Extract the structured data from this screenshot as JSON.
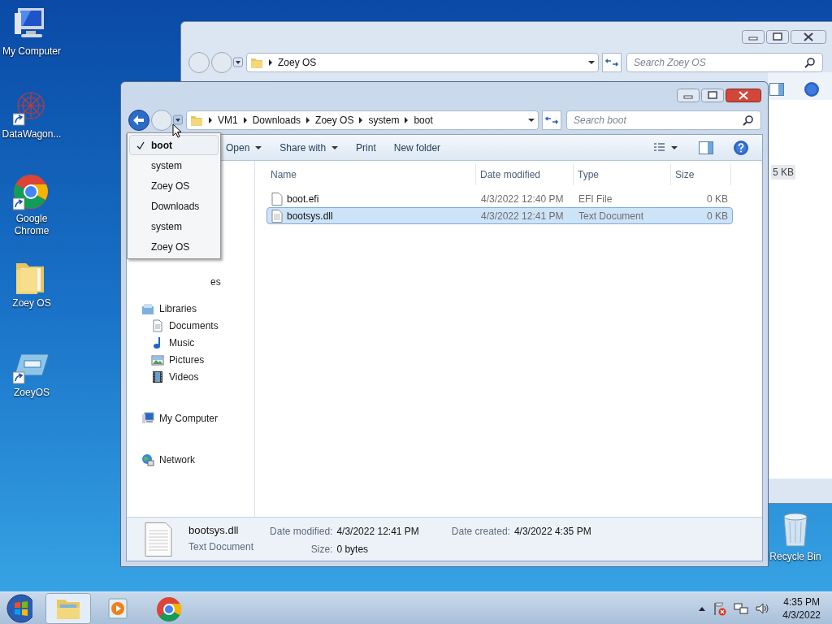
{
  "desktop_icons": [
    {
      "label": "My Computer",
      "kind": "computer",
      "shortcut": false
    },
    {
      "label": "DataWagon...",
      "kind": "web",
      "shortcut": true
    },
    {
      "label": "Google Chrome",
      "kind": "chrome",
      "shortcut": true
    },
    {
      "label": "Zoey OS",
      "kind": "folder",
      "shortcut": false
    },
    {
      "label": "ZoeyOS",
      "kind": "app",
      "shortcut": true
    }
  ],
  "back_window": {
    "breadcrumb": [
      "Zoey OS"
    ],
    "search": {
      "placeholder": "Search Zoey OS"
    },
    "size_cell": "5 KB"
  },
  "window": {
    "breadcrumb": [
      "VM1",
      "Downloads",
      "Zoey OS",
      "system",
      "boot"
    ],
    "search": {
      "placeholder": "Search boot"
    },
    "toolbar": [
      {
        "label": "Open",
        "dropdown": true
      },
      {
        "label": "Share with",
        "dropdown": true
      },
      {
        "label": "Print",
        "dropdown": false
      },
      {
        "label": "New folder",
        "dropdown": false
      }
    ],
    "nav": [
      {
        "label": "es",
        "kind": "partial"
      },
      {
        "label": "Libraries",
        "kind": "libraries",
        "children": [
          {
            "label": "Documents",
            "kind": "document"
          },
          {
            "label": "Music",
            "kind": "music"
          },
          {
            "label": "Pictures",
            "kind": "picture"
          },
          {
            "label": "Videos",
            "kind": "video"
          }
        ]
      },
      {
        "label": "My Computer",
        "kind": "computer"
      },
      {
        "label": "Network",
        "kind": "network"
      }
    ],
    "columns": [
      "Name",
      "Date modified",
      "Type",
      "Size"
    ],
    "files": [
      {
        "name": "boot.efi",
        "date": "4/3/2022 12:40 PM",
        "type": "EFI File",
        "size": "0 KB",
        "selected": false
      },
      {
        "name": "bootsys.dll",
        "date": "4/3/2022 12:41 PM",
        "type": "Text Document",
        "size": "0 KB",
        "selected": true
      }
    ],
    "details": {
      "name": "bootsys.dll",
      "type": "Text Document",
      "field_columns": [
        [
          {
            "label": "Date modified:",
            "value": "4/3/2022 12:41 PM"
          },
          {
            "label": "Size:",
            "value": "0 bytes"
          }
        ],
        [
          {
            "label": "Date created:",
            "value": "4/3/2022 4:35 PM"
          }
        ]
      ]
    }
  },
  "history_menu": [
    {
      "label": "boot",
      "selected": true
    },
    {
      "label": "system",
      "selected": false
    },
    {
      "label": "Zoey OS",
      "selected": false
    },
    {
      "label": "Downloads",
      "selected": false
    },
    {
      "label": "system",
      "selected": false
    },
    {
      "label": "Zoey OS",
      "selected": false
    }
  ],
  "recycle_bin": {
    "label": "Recycle Bin"
  },
  "taskbar": {
    "apps": [
      {
        "kind": "explorer",
        "active": true
      },
      {
        "kind": "media",
        "active": false
      },
      {
        "kind": "chrome",
        "active": false
      }
    ],
    "time": "4:35 PM",
    "date": "4/3/2022"
  }
}
